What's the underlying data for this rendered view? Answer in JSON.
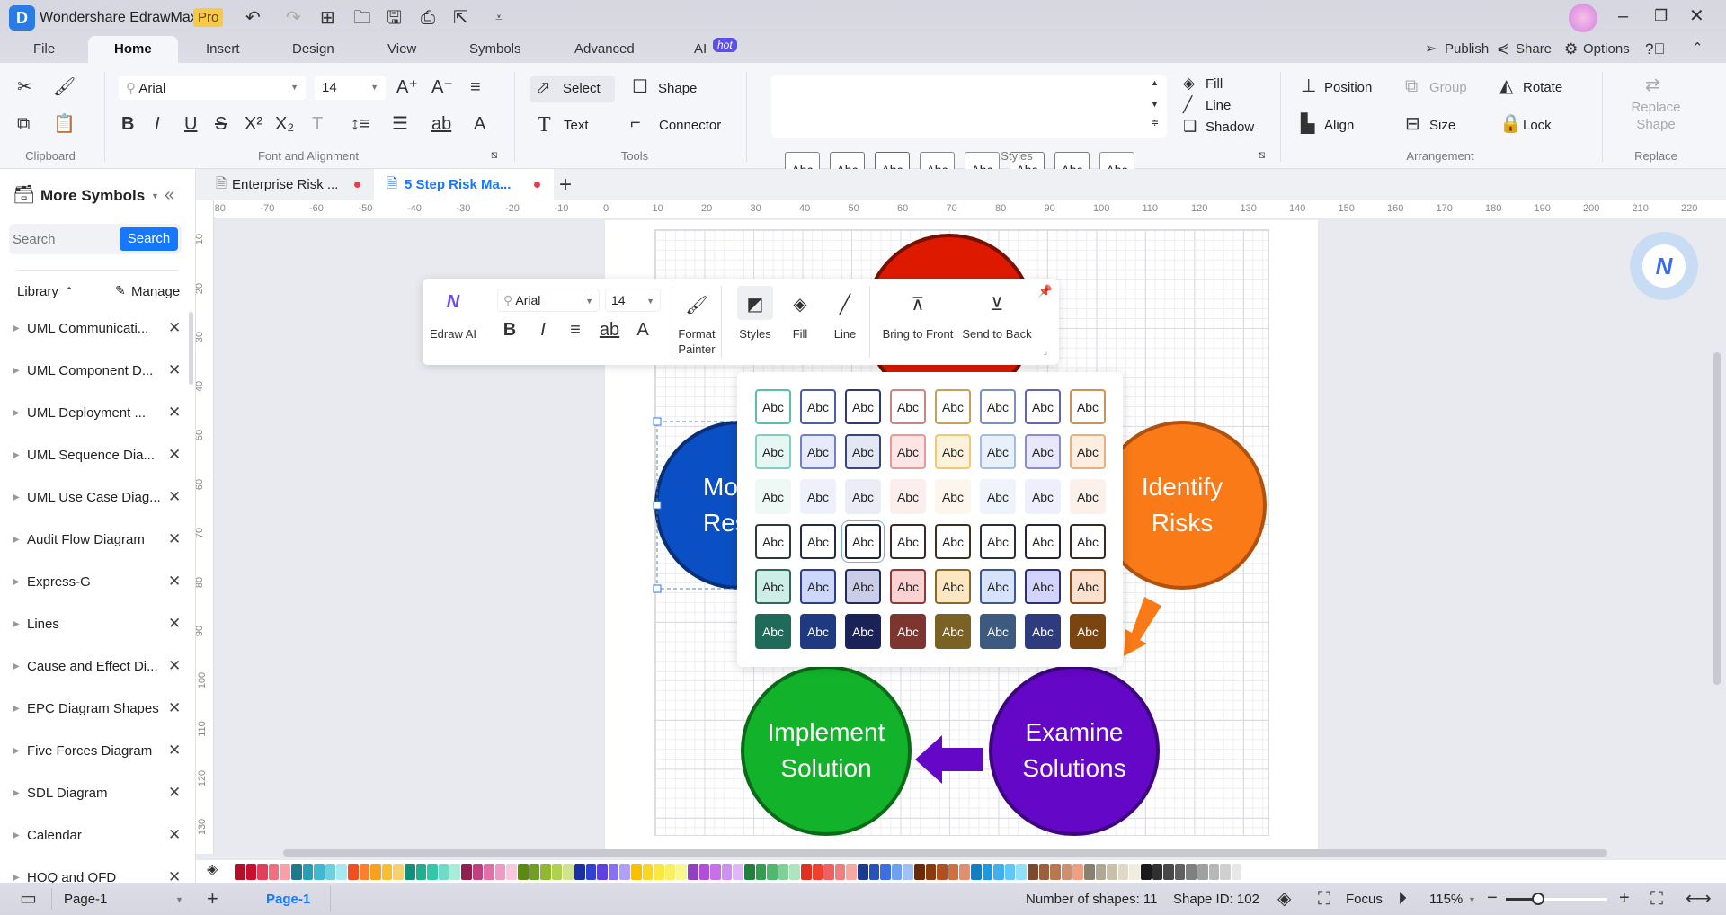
{
  "app": {
    "title": "Wondershare EdrawMax",
    "badge": "Pro",
    "window_controls": [
      "minimize",
      "restore",
      "close"
    ]
  },
  "menu": {
    "tabs": [
      "File",
      "Home",
      "Insert",
      "Design",
      "View",
      "Symbols",
      "Advanced",
      "AI"
    ],
    "active": "Home",
    "ai_badge": "hot",
    "right": {
      "publish": "Publish",
      "share": "Share",
      "options": "Options"
    }
  },
  "ribbon": {
    "groups": {
      "clipboard": "Clipboard",
      "font": "Font and Alignment",
      "tools": "Tools",
      "styles": "Styles",
      "arrangement": "Arrangement",
      "replace": "Replace"
    },
    "font_name": "Arial",
    "font_size": "14",
    "tools": {
      "select": "Select",
      "shape": "Shape",
      "text": "Text",
      "connector": "Connector"
    },
    "style_sample": "Abc",
    "style_borders": [
      "#6a8aa0",
      "#6a7a90",
      "#5a6a80",
      "#7a8aa0",
      "#8a9a70",
      "#6a7a90",
      "#7a7a90",
      "#8a9a70"
    ],
    "format": {
      "fill": "Fill",
      "line": "Line",
      "shadow": "Shadow"
    },
    "arrangement": {
      "position": "Position",
      "group": "Group",
      "rotate": "Rotate",
      "align": "Align",
      "size": "Size",
      "lock": "Lock"
    },
    "replace_shape": "Replace Shape"
  },
  "sidebar": {
    "title": "More Symbols",
    "search_placeholder": "Search",
    "search_button": "Search",
    "library": "Library",
    "manage": "Manage",
    "items": [
      "UML Communicati...",
      "UML Component D...",
      "UML Deployment ...",
      "UML Sequence Dia...",
      "UML Use Case Diag...",
      "Audit Flow Diagram",
      "Express-G",
      "Lines",
      "Cause and Effect Di...",
      "EPC Diagram Shapes",
      "Five Forces Diagram",
      "SDL Diagram",
      "Calendar",
      "HOQ and QFD"
    ]
  },
  "doc_tabs": [
    {
      "label": "Enterprise Risk ...",
      "active": false,
      "unsaved": true
    },
    {
      "label": "5 Step Risk Ma...",
      "active": true,
      "unsaved": true
    }
  ],
  "ruler": {
    "h": [
      "-80",
      "-70",
      "-60",
      "-50",
      "-40",
      "-30",
      "-20",
      "-10",
      "0",
      "10",
      "20",
      "30",
      "40",
      "50",
      "60",
      "70",
      "80",
      "90",
      "100",
      "110",
      "120",
      "130",
      "140",
      "150",
      "160",
      "170",
      "180",
      "190",
      "200",
      "210",
      "220"
    ],
    "v": [
      "10",
      "20",
      "30",
      "40",
      "50",
      "60",
      "70",
      "80",
      "90",
      "100",
      "110",
      "120",
      "130"
    ]
  },
  "diagram": {
    "shapes": [
      {
        "label": "",
        "fill": "#dd1a00",
        "stroke": "#7a0e00"
      },
      {
        "label": "Monitor\nResults",
        "fill": "#0b4fc4",
        "stroke": "#08307a"
      },
      {
        "label": "Identify\nRisks",
        "fill": "#f97a16",
        "stroke": "#b0520e"
      },
      {
        "label": "Implement\nSolution",
        "fill": "#12b32a",
        "stroke": "#0a6a18"
      },
      {
        "label": "Examine\nSolutions",
        "fill": "#6407c7",
        "stroke": "#3d0680"
      }
    ],
    "arrow_colors": [
      "#6407c7",
      "#f97a16"
    ]
  },
  "float_toolbar": {
    "edraw_ai": "Edraw AI",
    "font": "Arial",
    "size": "14",
    "format_painter": "Format\nPainter",
    "styles": "Styles",
    "fill": "Fill",
    "line": "Line",
    "bring_front": "Bring to Front",
    "send_back": "Send to Back"
  },
  "style_gallery": {
    "sample": "Abc",
    "selected": [
      3,
      2
    ],
    "rows": [
      {
        "fill": [
          "#ffffff",
          "#ffffff",
          "#ffffff",
          "#ffffff",
          "#ffffff",
          "#ffffff",
          "#ffffff",
          "#ffffff"
        ],
        "border": [
          "#5bbfa8",
          "#4b5ea8",
          "#2f3a6e",
          "#c98484",
          "#c9a05a",
          "#7b8fc0",
          "#6166b0",
          "#c8945a"
        ],
        "text": "#222"
      },
      {
        "fill": [
          "#e6f7f3",
          "#e6ebfb",
          "#e3e6f3",
          "#fde5e5",
          "#fdf2dc",
          "#e8f0fb",
          "#e8e8fb",
          "#fdeedf"
        ],
        "border": [
          "#7fd0c0",
          "#7080c8",
          "#3a4580",
          "#e39a9a",
          "#f0c870",
          "#a0bce0",
          "#8a8ad8",
          "#e8b080"
        ],
        "text": "#222"
      },
      {
        "fill": [
          "#eef8f5",
          "#eef0fc",
          "#ebecf5",
          "#fdeeee",
          "#fdf6ec",
          "#eef3fc",
          "#eeeefc",
          "#fcf1ea"
        ],
        "border": [
          "transparent",
          "transparent",
          "transparent",
          "transparent",
          "transparent",
          "transparent",
          "transparent",
          "transparent"
        ],
        "text": "#222"
      },
      {
        "fill": [
          "#ffffff",
          "#ffffff",
          "#ffffff",
          "#ffffff",
          "#ffffff",
          "#ffffff",
          "#ffffff",
          "#ffffff"
        ],
        "border": [
          "#2c3a3a",
          "#252a45",
          "#1f2538",
          "#3d2828",
          "#3a3220",
          "#2a2f40",
          "#25253a",
          "#3a2a1e"
        ],
        "text": "#222"
      },
      {
        "fill": [
          "#cdeee6",
          "#cdd6fb",
          "#cbcde6",
          "#fbd2d2",
          "#fde6c2",
          "#d6e3fb",
          "#d3d4fb",
          "#fde0cd"
        ],
        "border": [
          "#2e6a5a",
          "#2d3e8a",
          "#242a5a",
          "#8a3a3a",
          "#8a6a2a",
          "#3d5a8a",
          "#2d2f7a",
          "#8a4a1a"
        ],
        "text": "#222"
      },
      {
        "fill": [
          "#1f6a58",
          "#1f3a80",
          "#1a2258",
          "#7d3530",
          "#7a6124",
          "#3d5a80",
          "#2e3b7e",
          "#7a4510"
        ],
        "border": [
          "transparent",
          "transparent",
          "transparent",
          "transparent",
          "transparent",
          "transparent",
          "transparent",
          "transparent"
        ],
        "text": "#ffffff"
      }
    ]
  },
  "palette": [
    "#b0102a",
    "#c8102e",
    "#e0405a",
    "#f07080",
    "#f8a0a8",
    "#1e7a8a",
    "#2aa0b8",
    "#40b8d0",
    "#70d0e0",
    "#a8e8f0",
    "#f05020",
    "#f88030",
    "#f8a020",
    "#f8c030",
    "#f8d070",
    "#10907a",
    "#20b090",
    "#30c8a8",
    "#70dcc8",
    "#a8ecdc",
    "#902050",
    "#c04080",
    "#e070a8",
    "#f098c8",
    "#f8c8e0",
    "#5a8a10",
    "#70a020",
    "#90b830",
    "#b0d050",
    "#d0e490",
    "#1a30a0",
    "#3040d0",
    "#6040e0",
    "#8870f0",
    "#b0a0f8",
    "#f8c000",
    "#f8d820",
    "#f8e840",
    "#f8f060",
    "#f8f890",
    "#9040c0",
    "#b050d8",
    "#c870e8",
    "#d090f0",
    "#e0b8f8",
    "#208040",
    "#30a050",
    "#50b870",
    "#80d098",
    "#b0e4c0",
    "#e03020",
    "#f04030",
    "#f06060",
    "#f08080",
    "#f8a8a0",
    "#1a3a90",
    "#2a50c0",
    "#3a70e0",
    "#70a0f0",
    "#a0c0f8",
    "#6a2a08",
    "#8a3a10",
    "#b05020",
    "#d07040",
    "#e09070",
    "#1080c0",
    "#2098e0",
    "#40b0f0",
    "#60c8f8",
    "#90e0f8",
    "#7a4a30",
    "#9a6040",
    "#b87850",
    "#d09070",
    "#f0a080",
    "#8a8070",
    "#b0a890",
    "#c8c0a8",
    "#e0d8c8",
    "#f0ece0",
    "#1a1a1a",
    "#303030",
    "#484848",
    "#606060",
    "#808080",
    "#a0a0a0",
    "#b8b8b8",
    "#d0d0d0",
    "#e8e8e8",
    "#ffffff"
  ],
  "status": {
    "page_select": "Page-1",
    "page_tab": "Page-1",
    "shapes": "Number of shapes: 11",
    "shape_id": "Shape ID: 102",
    "focus": "Focus",
    "zoom": "115%",
    "zoom_level_percent": 115
  }
}
